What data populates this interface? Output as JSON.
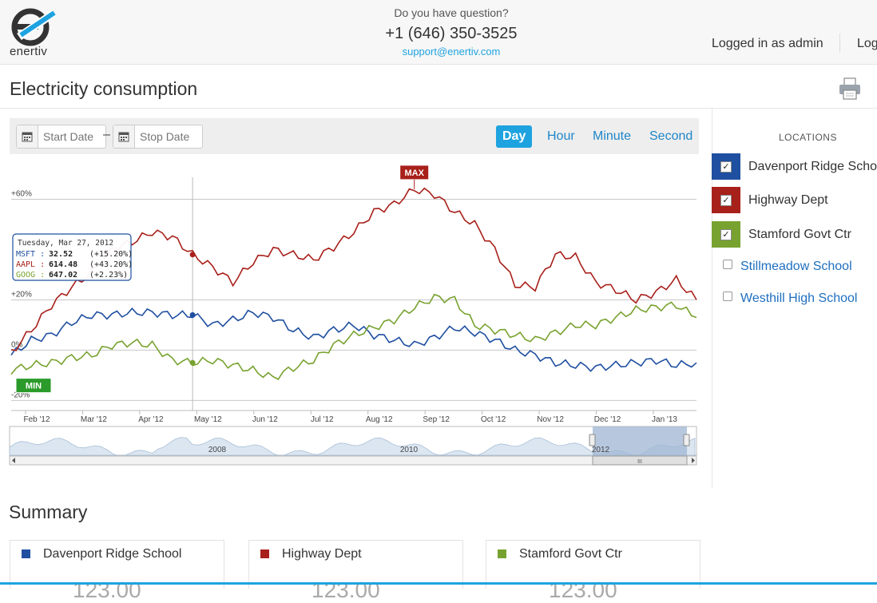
{
  "header": {
    "logo_text": "enertiv",
    "question": "Do you have question?",
    "phone": "+1 (646) 350-3525",
    "email": "support@enertiv.com",
    "user_label": "Logged in as admin",
    "logout_label": "Logout"
  },
  "page": {
    "title": "Electricity consumption"
  },
  "toolbar": {
    "start_placeholder": "Start Date",
    "stop_placeholder": "Stop Date",
    "dash": "–",
    "tabs": [
      {
        "label": "Day",
        "active": true
      },
      {
        "label": "Hour",
        "active": false
      },
      {
        "label": "Minute",
        "active": false
      },
      {
        "label": "Second",
        "active": false
      }
    ]
  },
  "chart_data": {
    "type": "line",
    "y_ticks": [
      "+60%",
      "+20%",
      "0%",
      "-20%"
    ],
    "y_values": [
      60,
      20,
      0,
      -20
    ],
    "ylim": [
      -24,
      70
    ],
    "x_ticks": [
      "Feb '12",
      "Mar '12",
      "Apr '12",
      "May '12",
      "Jun '12",
      "Jul '12",
      "Aug '12",
      "Sep '12",
      "Oct '12",
      "Nov '12",
      "Dec '12",
      "Jan '13"
    ],
    "navigator_labels": [
      "2008",
      "2010",
      "2012"
    ],
    "navigator_scroll_label": "III",
    "series": [
      {
        "name": "MSFT",
        "color": "#1f4fa0",
        "values": [
          -2,
          4,
          6,
          11,
          14,
          14,
          15,
          15,
          14,
          14,
          10,
          12,
          15,
          13,
          8,
          5,
          8,
          10,
          6,
          4,
          2,
          5,
          9,
          7,
          4,
          0,
          -2,
          -5,
          -6,
          -7,
          -6,
          -5,
          -4,
          -6,
          -5
        ]
      },
      {
        "name": "AAPL",
        "color": "#a8201a",
        "values": [
          -1,
          8,
          18,
          25,
          31,
          40,
          43,
          47,
          45,
          38,
          33,
          27,
          35,
          40,
          38,
          36,
          41,
          47,
          55,
          58,
          64,
          62,
          55,
          50,
          40,
          26,
          25,
          38,
          37,
          27,
          24,
          20,
          23,
          28,
          20
        ]
      },
      {
        "name": "GOOG",
        "color": "#78a22f",
        "values": [
          -8,
          -6,
          -5,
          -3,
          -2,
          2,
          3,
          2,
          -4,
          -5,
          -4,
          -6,
          -8,
          -11,
          -7,
          -4,
          2,
          6,
          9,
          12,
          17,
          21,
          20,
          10,
          8,
          6,
          4,
          7,
          10,
          10,
          13,
          16,
          17,
          18,
          13
        ]
      }
    ],
    "tooltip": {
      "date": "Tuesday, Mar 27, 2012",
      "rows": [
        {
          "name": "MSFT",
          "value": "32.52",
          "change": "(+15.20%)",
          "color": "#1f4fa0"
        },
        {
          "name": "AAPL",
          "value": "614.48",
          "change": "(+43.20%)",
          "color": "#a8201a"
        },
        {
          "name": "GOOG",
          "value": "647.02",
          "change": "(+2.23%)",
          "color": "#78a22f"
        }
      ]
    },
    "max_label": "MAX",
    "min_label": "MIN"
  },
  "locations": {
    "heading": "LOCATIONS",
    "checked": [
      {
        "name": "Davenport Ridge School",
        "color": "#1f4fa0"
      },
      {
        "name": "Highway Dept",
        "color": "#a8201a"
      },
      {
        "name": "Stamford Govt Ctr",
        "color": "#78a22f"
      }
    ],
    "check_mark": "✓",
    "unchecked": [
      {
        "name": "Stillmeadow School"
      },
      {
        "name": "Westhill High School"
      }
    ]
  },
  "summary": {
    "title": "Summary",
    "cards": [
      {
        "name": "Davenport Ridge School",
        "color": "#1f4fa0",
        "value": "123.00"
      },
      {
        "name": "Highway Dept",
        "color": "#a8201a",
        "value": "123.00"
      },
      {
        "name": "Stamford Govt Ctr",
        "color": "#78a22f",
        "value": "123.00"
      }
    ]
  }
}
